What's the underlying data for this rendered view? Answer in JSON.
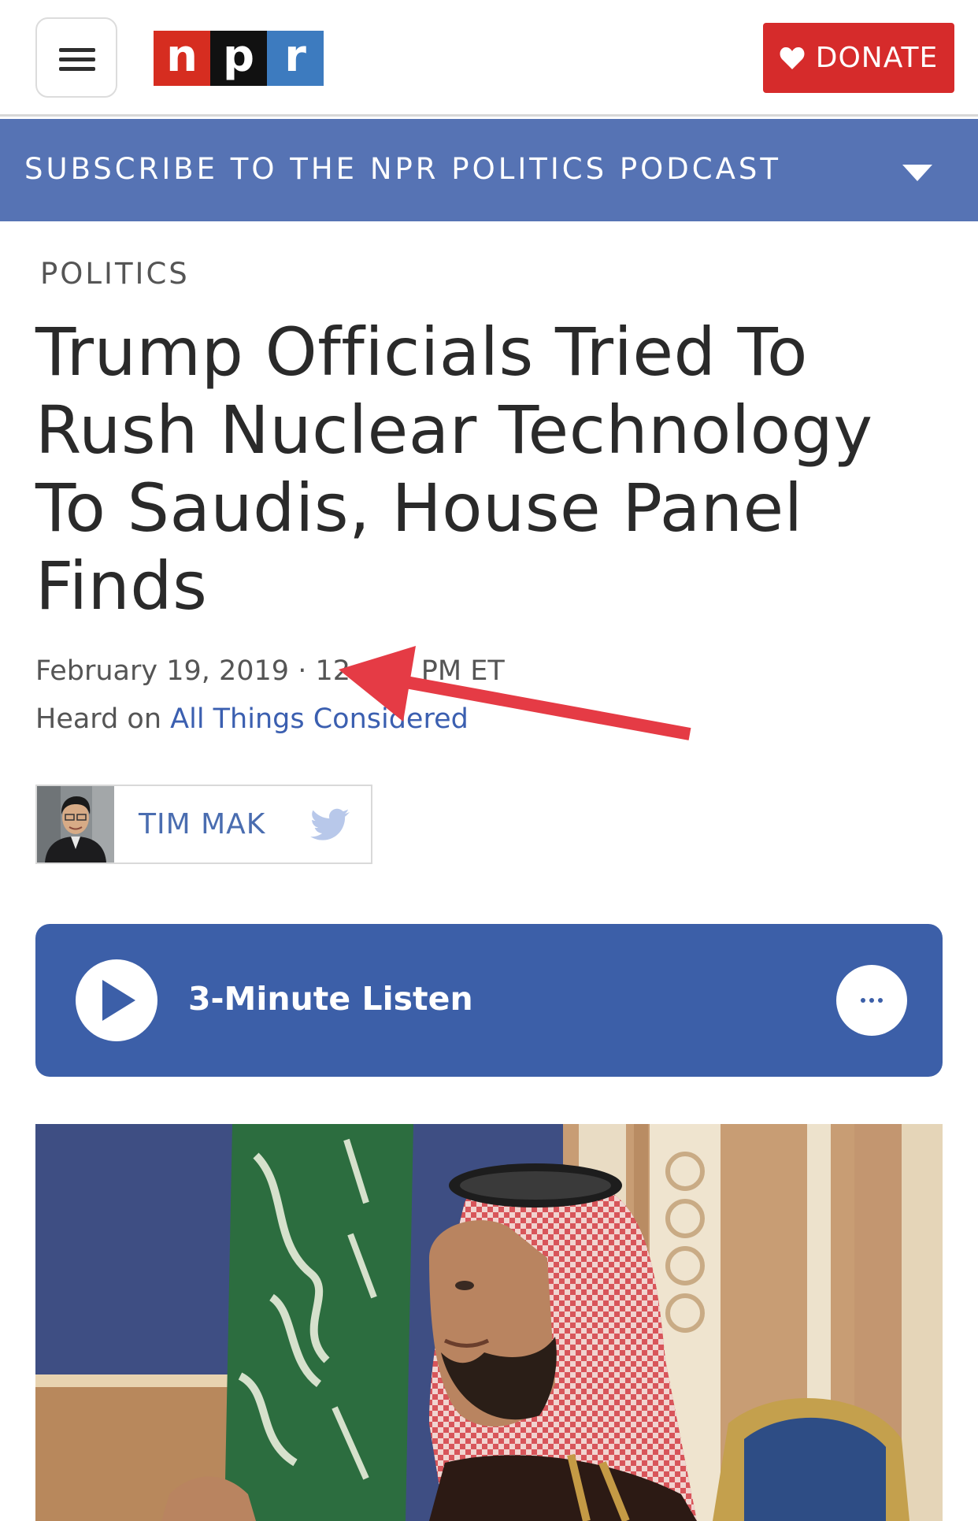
{
  "header": {
    "logo_letters": [
      "n",
      "p",
      "r"
    ],
    "logo_colors": [
      "#d62d20",
      "#111111",
      "#3d7bbf"
    ],
    "donate_label": "DONATE",
    "donate_color": "#d62b2b"
  },
  "subscribe_bar": {
    "label": "SUBSCRIBE TO THE NPR POLITICS PODCAST",
    "background": "#5673b4"
  },
  "article": {
    "section": "POLITICS",
    "headline": "Trump Officials Tried To Rush Nuclear Technology To Saudis, House Panel Finds",
    "date": "February 19, 2019 · 12:",
    "time_suffix": "PM ET",
    "heard_on_prefix": "Heard on",
    "show_name": "All Things Considered"
  },
  "byline": {
    "author": "TIM MAK",
    "social_icon": "twitter-icon"
  },
  "audio": {
    "label": "3-Minute Listen",
    "play_icon": "play-icon",
    "more_icon": "more-options-icon",
    "background": "#3c5fa8"
  },
  "annotation": {
    "type": "arrow",
    "color": "#e53b45"
  }
}
